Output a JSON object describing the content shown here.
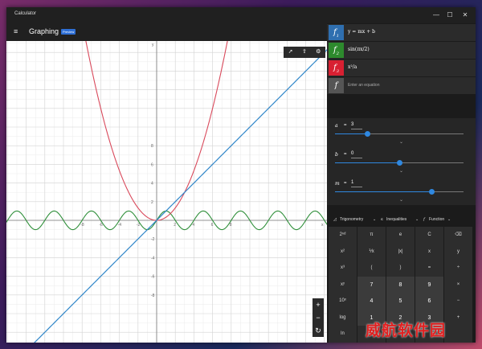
{
  "window": {
    "title": "Calculator",
    "controls": [
      "—",
      "☐",
      "✕"
    ]
  },
  "header": {
    "mode": "Graphing",
    "badge": "Preview",
    "menu_icon": "hamburger-icon"
  },
  "graph": {
    "tools": [
      "trace-icon",
      "share-icon",
      "graph-options-icon"
    ],
    "zoom": [
      "+",
      "−",
      "↻"
    ],
    "x_ticks": [
      "-8",
      "-6",
      "-4",
      "-2",
      "2",
      "4",
      "6",
      "8"
    ],
    "y_ticks": [
      "8",
      "6",
      "4",
      "2",
      "-2",
      "-4",
      "-6",
      "-8"
    ],
    "y_label": "y",
    "x_label": "x",
    "colors": {
      "line": "#2f86c9",
      "parabola": "#d9495b",
      "wave": "#2f8f3a"
    }
  },
  "equations": [
    {
      "symbol": "f",
      "sub": "1",
      "expr": "y = mx + b",
      "color": "#2f6fb0"
    },
    {
      "symbol": "f",
      "sub": "2",
      "expr": "sin(πx/2)",
      "color": "#2d8a2d"
    },
    {
      "symbol": "f",
      "sub": "3",
      "expr": "x²/a",
      "color": "#d82032"
    },
    {
      "symbol": "f",
      "sub": "",
      "placeholder": "Enter an equation",
      "color": "#555555"
    }
  ],
  "variables": [
    {
      "name": "a",
      "value": "3",
      "fraction": 0.25
    },
    {
      "name": "b",
      "value": "0",
      "fraction": 0.5
    },
    {
      "name": "m",
      "value": "1",
      "fraction": 0.75
    }
  ],
  "keyboard": {
    "tabs": {
      "trig": "Trigonometry",
      "ineq": "Inequalities",
      "func": "Function"
    },
    "rows": [
      [
        "2ⁿᵈ",
        "π",
        "e",
        "C",
        "⌫"
      ],
      [
        "x²",
        "⅟x",
        "|x|",
        "x",
        "y"
      ],
      [
        "x³",
        "(",
        ")",
        "=",
        "÷"
      ],
      [
        "xʸ",
        "7",
        "8",
        "9",
        "×"
      ],
      [
        "10ˣ",
        "4",
        "5",
        "6",
        "−"
      ],
      [
        "log",
        "1",
        "2",
        "3",
        "+"
      ],
      [
        "ln",
        "",
        "",
        "",
        ""
      ]
    ]
  },
  "watermark": "威航软件园"
}
